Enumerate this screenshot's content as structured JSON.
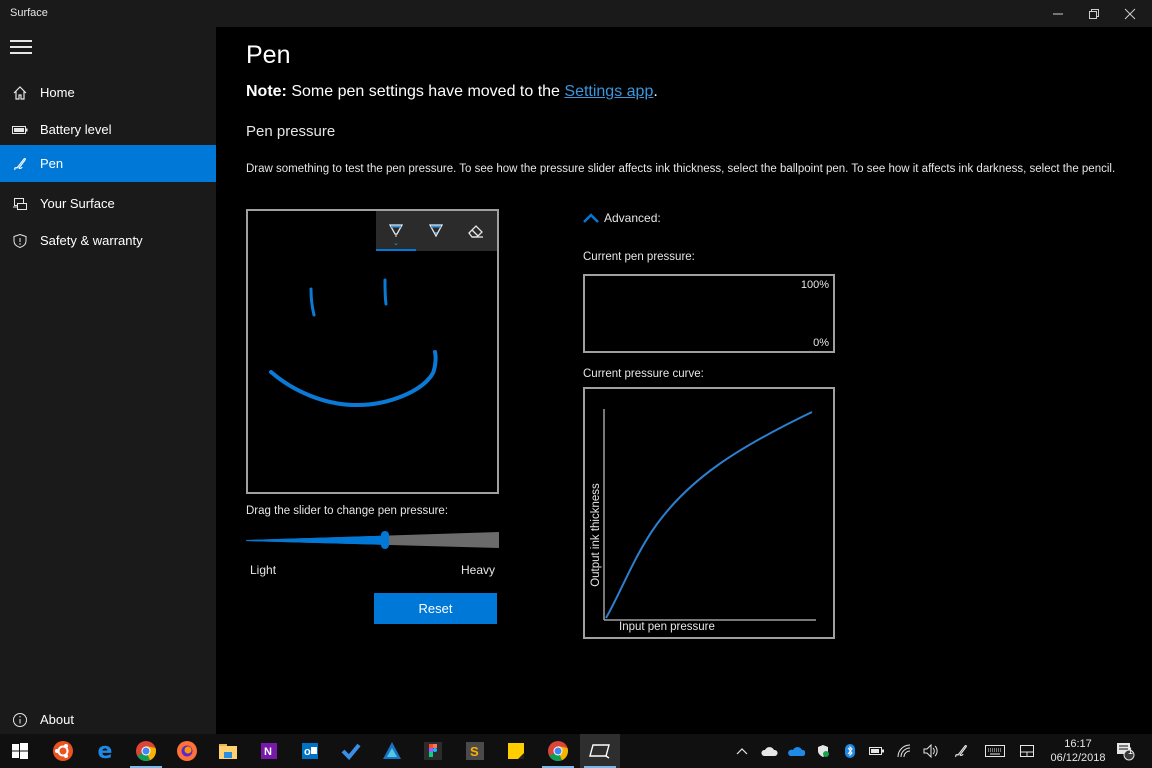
{
  "window": {
    "title": "Surface",
    "controls": {
      "minimize": "minimize",
      "restore": "restore",
      "close": "close"
    }
  },
  "sidebar": {
    "menu_icon": "hamburger-icon",
    "items": [
      {
        "label": "Home",
        "icon": "home-icon",
        "active": false
      },
      {
        "label": "Battery level",
        "icon": "battery-icon",
        "active": false
      },
      {
        "label": "Pen",
        "icon": "pen-icon",
        "active": true
      },
      {
        "label": "Your Surface",
        "icon": "devices-icon",
        "active": false
      },
      {
        "label": "Safety & warranty",
        "icon": "shield-icon",
        "active": false
      }
    ],
    "footer": {
      "label": "About",
      "icon": "info-icon"
    }
  },
  "main": {
    "title": "Pen",
    "note": {
      "prefix": "Note:",
      "text": " Some pen settings have moved to the ",
      "link": "Settings app",
      "suffix": "."
    },
    "section_title": "Pen pressure",
    "description": "Draw something to test the pen pressure. To see how the pressure slider affects ink thickness, select the ballpoint pen. To see how it affects ink darkness, select the pencil.",
    "ink_toolbar": {
      "tools": [
        {
          "name": "ballpoint-pen",
          "icon": "ballpoint-pen-icon",
          "selected": true
        },
        {
          "name": "pencil",
          "icon": "pencil-icon",
          "selected": false
        },
        {
          "name": "eraser",
          "icon": "eraser-icon",
          "selected": false
        }
      ]
    },
    "slider": {
      "label": "Drag the slider to change pen pressure:",
      "min_label": "Light",
      "max_label": "Heavy",
      "value_fraction": 0.55
    },
    "reset_label": "Reset",
    "advanced": {
      "label": "Advanced:",
      "expanded": true,
      "current_pressure_label": "Current pen pressure:",
      "pressure_max": "100%",
      "pressure_min": "0%",
      "curve_label": "Current pressure curve:",
      "curve_x_label": "Input pen pressure",
      "curve_y_label": "Output ink thickness"
    }
  },
  "taskbar": {
    "apps": [
      {
        "name": "start",
        "icon": "windows-icon"
      },
      {
        "name": "ubuntu",
        "icon": "ubuntu-icon"
      },
      {
        "name": "edge",
        "icon": "edge-icon"
      },
      {
        "name": "chrome",
        "icon": "chrome-icon",
        "open": true
      },
      {
        "name": "firefox",
        "icon": "firefox-icon"
      },
      {
        "name": "file-explorer",
        "icon": "folder-icon"
      },
      {
        "name": "onenote",
        "icon": "onenote-icon"
      },
      {
        "name": "outlook",
        "icon": "outlook-icon"
      },
      {
        "name": "todo",
        "icon": "checkmark-icon"
      },
      {
        "name": "affinity",
        "icon": "affinity-icon"
      },
      {
        "name": "figma",
        "icon": "figma-icon"
      },
      {
        "name": "sublime",
        "icon": "sublime-icon"
      },
      {
        "name": "sticky-notes",
        "icon": "sticky-notes-icon"
      },
      {
        "name": "chrome-2",
        "icon": "chrome-icon",
        "open": true
      },
      {
        "name": "surface",
        "icon": "surface-icon",
        "open": true,
        "active": true
      }
    ],
    "tray": [
      "chevron-up-icon",
      "cloud-sync-icon",
      "onedrive-icon",
      "defender-icon",
      "bluetooth-icon",
      "battery-icon",
      "wifi-icon",
      "volume-icon",
      "pen-icon",
      "keyboard-icon",
      "tablet-mode-icon"
    ],
    "time": "16:17",
    "date": "06/12/2018",
    "notifications_count": "1"
  },
  "colors": {
    "accent": "#0078d7",
    "sidebar_bg": "#1a1a1a",
    "content_bg": "#000000",
    "link": "#3a96dd"
  }
}
